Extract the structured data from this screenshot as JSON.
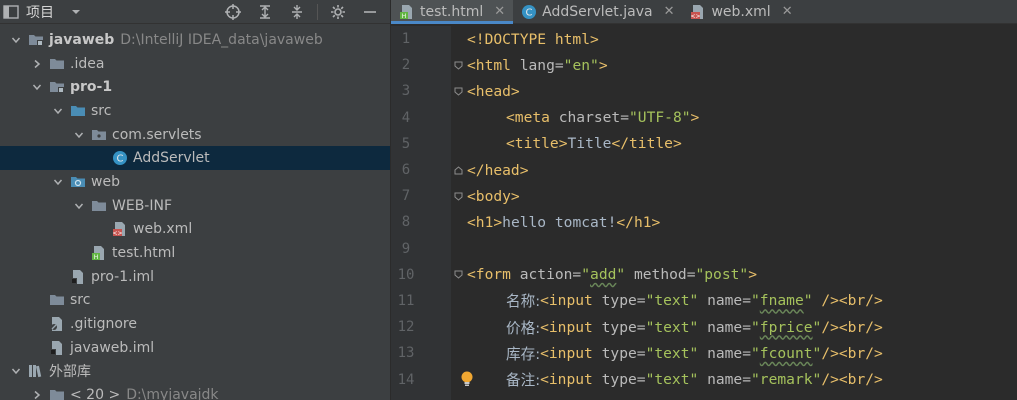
{
  "project_panel": {
    "title": "项目",
    "tree": [
      {
        "label": "javaweb",
        "path": "D:\\IntelliJ IDEA_data\\javaweb",
        "bold": true,
        "indent": 0,
        "chevron": "down",
        "icon": "module-folder-icon"
      },
      {
        "label": ".idea",
        "indent": 1,
        "chevron": "right",
        "icon": "folder-icon"
      },
      {
        "label": "pro-1",
        "bold": true,
        "indent": 1,
        "chevron": "down",
        "icon": "module-folder-icon"
      },
      {
        "label": "src",
        "indent": 2,
        "chevron": "down",
        "icon": "source-folder-icon"
      },
      {
        "label": "com.servlets",
        "indent": 3,
        "chevron": "down",
        "icon": "package-icon"
      },
      {
        "label": "AddServlet",
        "indent": 4,
        "chevron": "none",
        "icon": "java-class-icon",
        "selected": true
      },
      {
        "label": "web",
        "indent": 2,
        "chevron": "down",
        "icon": "web-folder-icon"
      },
      {
        "label": "WEB-INF",
        "indent": 3,
        "chevron": "down",
        "icon": "folder-icon"
      },
      {
        "label": "web.xml",
        "indent": 4,
        "chevron": "none",
        "icon": "xml-file-icon"
      },
      {
        "label": "test.html",
        "indent": 3,
        "chevron": "none",
        "icon": "html-file-icon"
      },
      {
        "label": "pro-1.iml",
        "indent": 2,
        "chevron": "none",
        "icon": "iml-file-icon"
      },
      {
        "label": "src",
        "indent": 1,
        "chevron": "none",
        "icon": "folder-icon"
      },
      {
        "label": ".gitignore",
        "indent": 1,
        "chevron": "none",
        "icon": "gitignore-file-icon"
      },
      {
        "label": "javaweb.iml",
        "indent": 1,
        "chevron": "none",
        "icon": "iml-file-icon"
      },
      {
        "label": "外部库",
        "indent": 0,
        "chevron": "down",
        "icon": "library-icon"
      },
      {
        "label": "< 20 >",
        "path": "D:\\myjavajdk",
        "indent": 1,
        "chevron": "right",
        "icon": "jdk-folder-icon"
      }
    ]
  },
  "tabs": [
    {
      "label": "test.html",
      "icon": "html-file-icon",
      "active": true
    },
    {
      "label": "AddServlet.java",
      "icon": "java-class-icon",
      "active": false
    },
    {
      "label": "web.xml",
      "icon": "xml-file-icon",
      "active": false
    }
  ],
  "line_numbers": [
    "1",
    "2",
    "3",
    "4",
    "5",
    "6",
    "7",
    "8",
    "9",
    "10",
    "11",
    "12",
    "13",
    "14"
  ],
  "code": {
    "doctype": "<!DOCTYPE html>",
    "html_open": "<html ",
    "lang_attr": "lang=",
    "lang_val": "\"en\"",
    "gt": ">",
    "head_open": "<head>",
    "meta_open": "<meta ",
    "charset_attr": "charset=",
    "charset_val": "\"UTF-8\"",
    "title_open": "<title>",
    "title_text": "Title",
    "title_close": "</title>",
    "head_close": "</head>",
    "body_open": "<body>",
    "h1_open": "<h1>",
    "h1_text": "hello tomcat!",
    "h1_close": "</h1>",
    "form_open": "<form ",
    "action_attr": "action=",
    "action_q1": "\"",
    "action_val": "add",
    "action_q2": "\"",
    "method_attr": " method=",
    "method_val": "\"post\"",
    "input_open": "<input ",
    "type_attr": "type=",
    "type_val": "\"text\"",
    "name_attr": " name=",
    "q": "\"",
    "f1_label": "名称:",
    "f1_name": "fname",
    "f1_end_a": "\" ",
    "f1_end_b": "/><br/>",
    "f2_label": "价格:",
    "f2_name": "fprice",
    "f3_label": "库存:",
    "f3_name": "fcount",
    "f4_label": "备注:",
    "f4_name": "remark",
    "end_b": "/><br/>"
  }
}
